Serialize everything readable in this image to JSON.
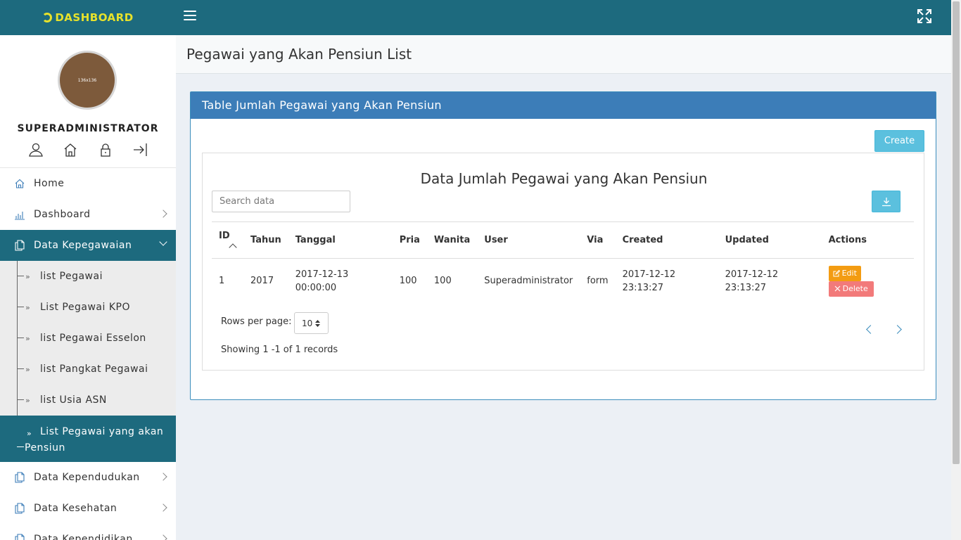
{
  "brand": {
    "name": "DASHBOARD",
    "accent": "#e7e22b",
    "topbar_color": "#1d6a7e"
  },
  "user": {
    "name": "SUPERADMINISTRATOR",
    "avatar_text": "136x136"
  },
  "sidebar": {
    "items": [
      {
        "label": "Home",
        "icon": "home-icon"
      },
      {
        "label": "Dashboard",
        "icon": "bar-chart-icon"
      },
      {
        "label": "Data Kepegawaian",
        "icon": "copy-icon"
      }
    ],
    "subitems": [
      {
        "label": "list Pegawai"
      },
      {
        "label": "List Pegawai KPO"
      },
      {
        "label": "list Pegawai Esselon"
      },
      {
        "label": "list Pangkat Pegawai"
      },
      {
        "label": "list Usia ASN"
      },
      {
        "label": "List Pegawai yang akan Pensiun"
      }
    ],
    "after": [
      {
        "label": "Data Kependudukan",
        "icon": "copy-icon"
      },
      {
        "label": "Data Kesehatan",
        "icon": "copy-icon"
      },
      {
        "label": "Data Kependidikan",
        "icon": "copy-icon"
      }
    ]
  },
  "page": {
    "title": "Pegawai yang Akan Pensiun List",
    "box_title": "Table Jumlah Pegawai yang Akan Pensiun",
    "create_label": "Create",
    "table_title": "Data Jumlah Pegawai yang Akan Pensiun",
    "search_placeholder": "Search data"
  },
  "table": {
    "headers": [
      "ID",
      "Tahun",
      "Tanggal",
      "Pria",
      "Wanita",
      "User",
      "Via",
      "Created",
      "Updated",
      "Actions"
    ],
    "rows": [
      {
        "id": "1",
        "tahun": "2017",
        "tanggal": [
          "2017-12-13",
          "00:00:00"
        ],
        "pria": "100",
        "wanita": "100",
        "user": "Superadministrator",
        "via": "form",
        "created": [
          "2017-12-12",
          "23:13:27"
        ],
        "updated": [
          "2017-12-12",
          "23:13:27"
        ],
        "edit_label": "Edit",
        "delete_label": "Delete"
      }
    ]
  },
  "pagination": {
    "rows_label": "Rows per page:",
    "rows_value": "10",
    "showing": "Showing 1 -1 of 1 records"
  }
}
